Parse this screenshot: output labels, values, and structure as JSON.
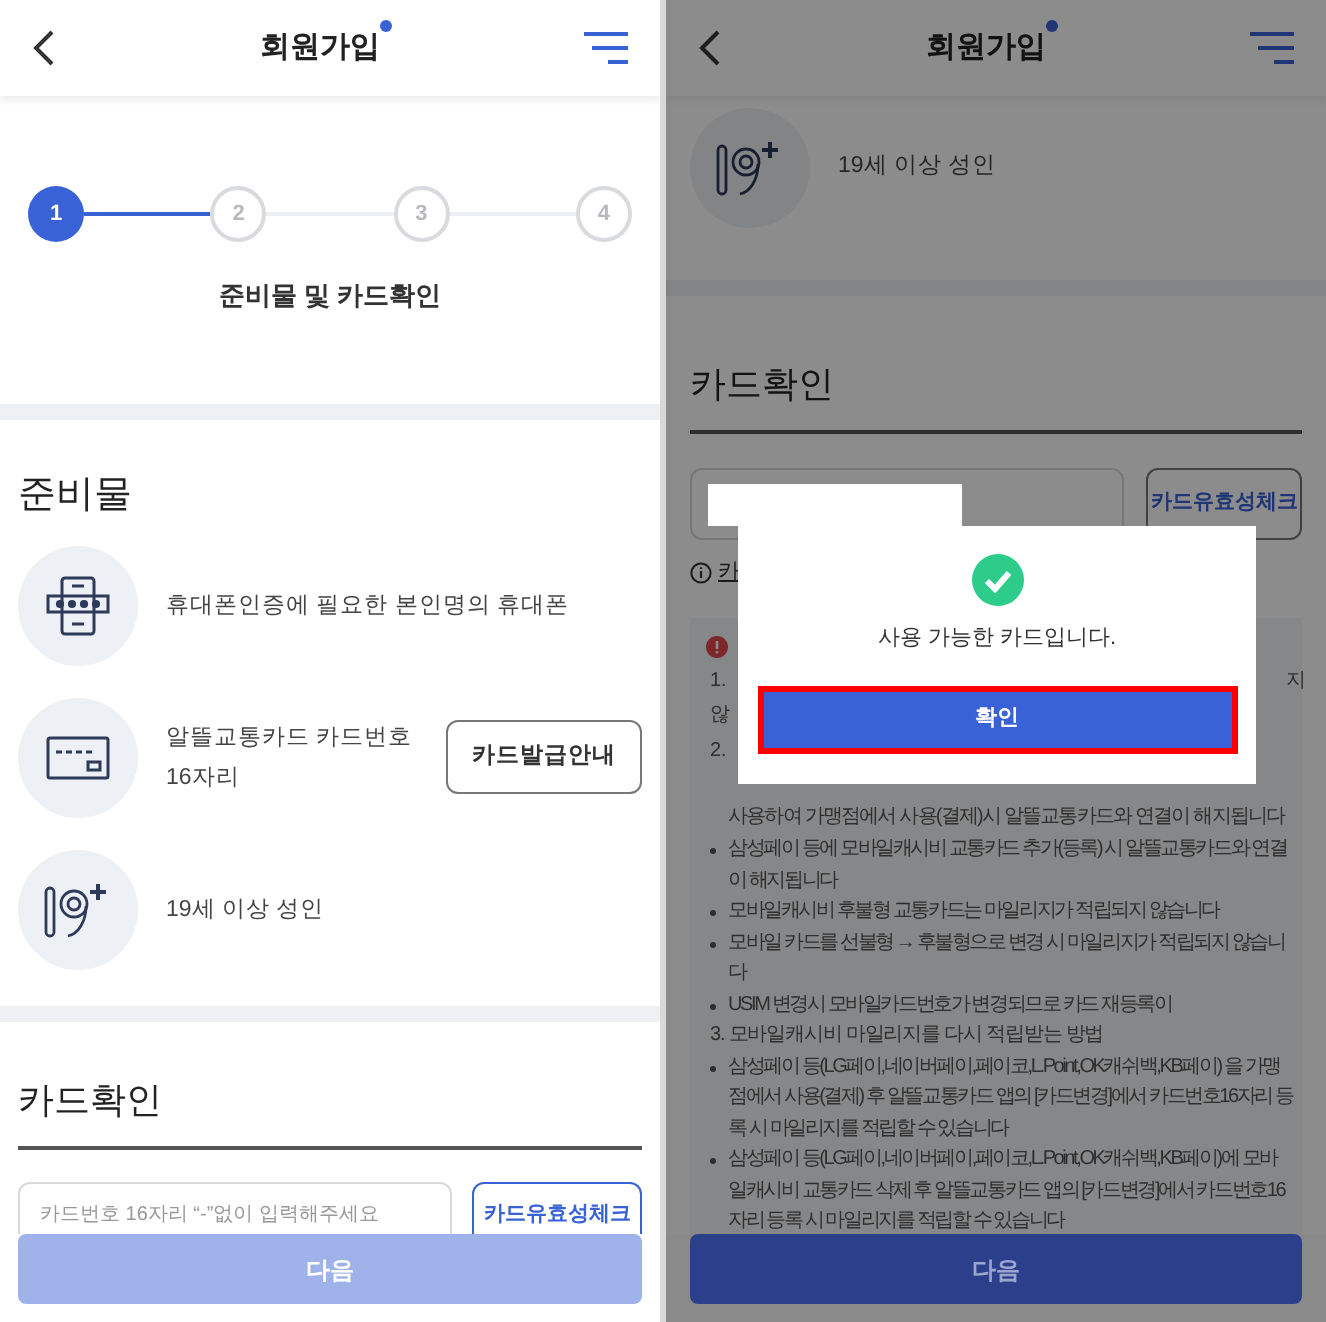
{
  "left": {
    "header": {
      "title": "회원가입"
    },
    "steps": [
      {
        "label": "1",
        "selected": true
      },
      {
        "label": "2",
        "selected": false
      },
      {
        "label": "3",
        "selected": false
      },
      {
        "label": "4",
        "selected": false
      }
    ],
    "step_caption": "준비물 및 카드확인",
    "prep": {
      "title": "준비물",
      "items": [
        {
          "kind": "phone",
          "text": "휴대폰인증에 필요한 본인명의 휴대폰"
        },
        {
          "kind": "card",
          "text": "알뜰교통카드 카드번호 16자리",
          "button": "카드발급안내"
        },
        {
          "kind": "age",
          "text": "19세 이상 성인"
        }
      ]
    },
    "card_check": {
      "title": "카드확인",
      "input": {
        "placeholder": "카드번호 16자리 “-”없이 입력해주세요"
      },
      "check_button": "카드유효성체크"
    },
    "next_button": {
      "label": "다음",
      "disabled": true
    }
  },
  "right": {
    "header": {
      "title": "회원가입"
    },
    "age_item": {
      "kind": "age",
      "text": "19세 이상 성인"
    },
    "card_check": {
      "title": "카드확인",
      "check_button": "카드유효성체크",
      "link": "카"
    },
    "notes": [
      {
        "kind": "fragment",
        "text": "1.",
        "tail": "지"
      },
      {
        "kind": "fragment",
        "text": "않"
      },
      {
        "kind": "fragment",
        "text": "2."
      },
      {
        "kind": "cont",
        "text": "사용하여 가맹점에서 사용(결제)시 알뜰교통카드와 연결이 해지됩니다"
      },
      {
        "kind": "bullet",
        "text": "삼성페이 등에 모바일캐시비 교통카드 추가(등록) 시 알뜰교통카드와 연결이 해지됩니다"
      },
      {
        "kind": "bullet",
        "text": "모바일캐시비 후불형 교통카드는 마일리지가 적립되지 않습니다"
      },
      {
        "kind": "bullet",
        "text": "모바일 카드를 선불형 → 후불형으로 변경 시 마일리지가 적립되지 않습니다"
      },
      {
        "kind": "bullet",
        "text": "USIM 변경시 모바일카드번호가 변경되므로 카드 재등록이"
      },
      {
        "kind": "numbered",
        "text": "3. 모바일캐시비 마일리지를 다시 적립받는 방법"
      },
      {
        "kind": "bullet",
        "text": "삼성페이 등(LG페이,네이버페이,페이코,L.Point,OK캐쉬백,KB페이) 을 가맹점에서 사용(결제) 후 알뜰교통카드 앱의 [카드변경]에서 카드번호16자리 등록 시 마일리지를 적립할 수 있습니다"
      },
      {
        "kind": "bullet",
        "text": "삼성페이 등(LG페이,네이버페이,페이코,L.Point,OK캐쉬백,KB페이)에 모바일캐시비 교통카드 삭제 후 알뜰교통카드 앱의 [카드변경]에서 카드번호16자리 등록 시 마일리지를 적립할 수 있습니다"
      }
    ],
    "dialog": {
      "message": "사용 가능한 카드입니다.",
      "confirm": "확인",
      "highlighted": true
    },
    "next_button": {
      "label": "다음",
      "disabled": false
    }
  }
}
